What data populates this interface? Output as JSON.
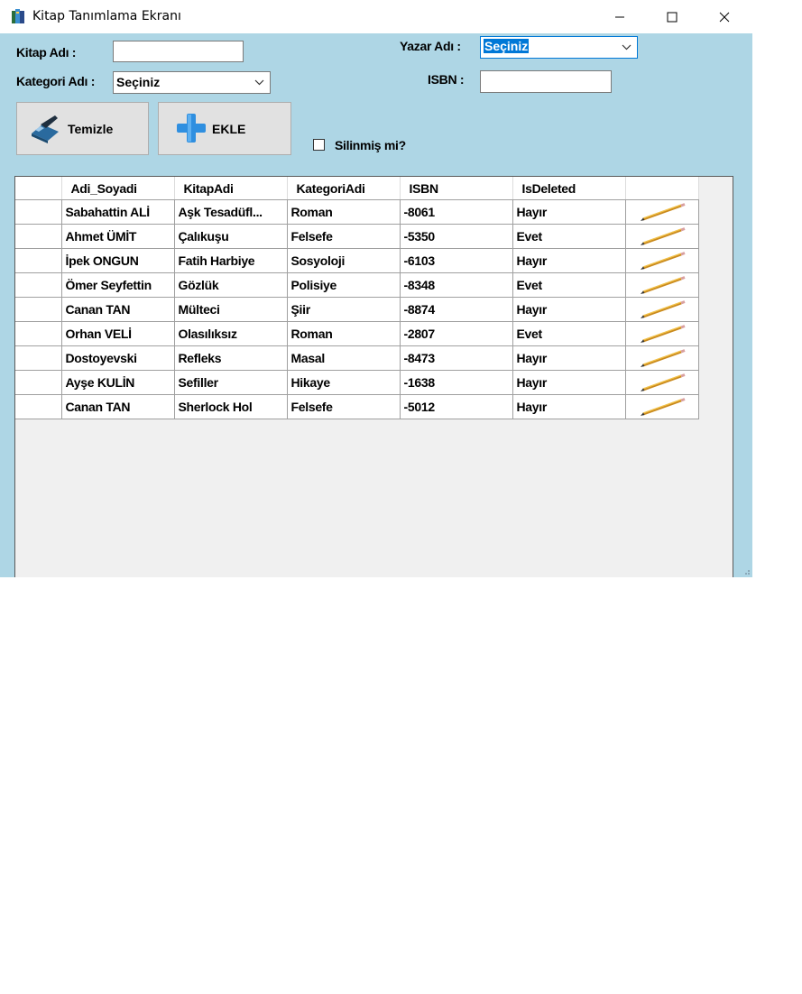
{
  "window": {
    "title": "Kitap Tanımlama Ekranı",
    "controls": {
      "minimize_icon": "minimize-icon",
      "maximize_icon": "maximize-icon",
      "close_icon": "close-icon"
    }
  },
  "form": {
    "kitap_adi_label": "Kitap Adı :",
    "kitap_adi_value": "",
    "kategori_adi_label": "Kategori Adı :",
    "kategori_adi_selected": "Seçiniz",
    "yazar_adi_label": "Yazar Adı :",
    "yazar_adi_selected": "Seçiniz",
    "isbn_label": "ISBN :",
    "isbn_value": "",
    "temizle_label": "Temizle",
    "ekle_label": "EKLE",
    "silinmis_label": "Silinmiş mi?",
    "silinmis_checked": false
  },
  "grid": {
    "columns": [
      "Adi_Soyadi",
      "KitapAdi",
      "KategoriAdi",
      "ISBN",
      "IsDeleted"
    ],
    "rows": [
      [
        "Sabahattin ALİ",
        "Aşk Tesadüfl...",
        "Roman",
        "-8061",
        "Hayır"
      ],
      [
        "Ahmet ÜMİT",
        "Çalıkuşu",
        "Felsefe",
        "-5350",
        "Evet"
      ],
      [
        "İpek ONGUN",
        "Fatih Harbiye",
        "Sosyoloji",
        "-6103",
        "Hayır"
      ],
      [
        "Ömer Seyfettin",
        "Gözlük",
        "Polisiye",
        "-8348",
        "Evet"
      ],
      [
        "Canan TAN",
        "Mülteci",
        "Şiir",
        "-8874",
        "Hayır"
      ],
      [
        "Orhan VELİ",
        "Olasılıksız",
        "Roman",
        "-2807",
        "Evet"
      ],
      [
        "Dostoyevski",
        "Refleks",
        "Masal",
        "-8473",
        "Hayır"
      ],
      [
        "Ayşe KULİN",
        "Sefiller",
        "Hikaye",
        "-1638",
        "Hayır"
      ],
      [
        "Canan TAN",
        "Sherlock Hol",
        "Felsefe",
        "-5012",
        "Hayır"
      ]
    ],
    "edit_icon": "pencil-icon"
  },
  "colors": {
    "form_background": "#aed6e5",
    "selection": "#0078d7",
    "ekle_icon": "#2f8fe0"
  }
}
